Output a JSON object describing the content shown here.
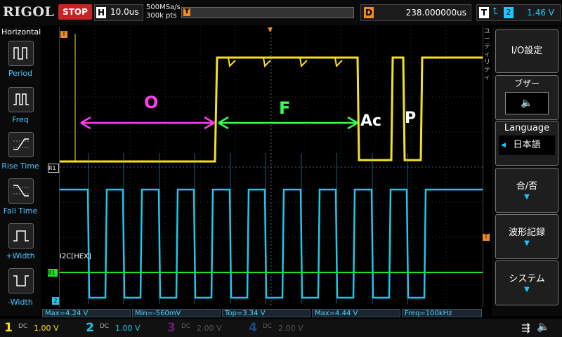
{
  "topbar": {
    "logo": "RIGOL",
    "run_state": "STOP",
    "timebase_tag": "H",
    "timebase": "10.0us",
    "sample_rate": "500MSa/s",
    "memory_depth": "300k pts",
    "trigger_marker": "T",
    "delay_tag": "D",
    "delay": "238.000000us",
    "trigger_tag": "T",
    "trigger_source": "2",
    "trigger_level": "1.46 V"
  },
  "left_panel": {
    "title": "Horizontal",
    "items": [
      {
        "label": "Period"
      },
      {
        "label": "Freq"
      },
      {
        "label": "Rise Time"
      },
      {
        "label": "Fall Time"
      },
      {
        "label": "+Width"
      },
      {
        "label": "-Width"
      }
    ]
  },
  "screen": {
    "annotations": {
      "o_label": "O",
      "f_label": "F",
      "ack_label": "Ac",
      "p_label": "P"
    },
    "markers": {
      "ch1_ref": "R1",
      "bus_ref": "B1",
      "ch2_ref": "2",
      "trig_left": "T",
      "trig_right": "T",
      "bus_label": "I2C[HEX]"
    },
    "scale_labels": [
      "ユ",
      "ー",
      "テ",
      "ィ",
      "リ",
      "テ",
      "ィ"
    ]
  },
  "right_panel": {
    "items": [
      {
        "label": "I/O設定"
      },
      {
        "label": "ブザー"
      },
      {
        "label": "Language"
      },
      {
        "label": "日本語"
      },
      {
        "label": "合/否"
      },
      {
        "label": "波形記録"
      },
      {
        "label": "システム"
      }
    ]
  },
  "measurements": [
    {
      "label": "Max=4.24 V"
    },
    {
      "label": "Min=-560mV"
    },
    {
      "label": "Top=3.34 V"
    },
    {
      "label": "Max=4.44 V"
    },
    {
      "label": "Freq=100kHz"
    }
  ],
  "channels": [
    {
      "num": "1",
      "coupling": "DC",
      "volts": "1.00 V",
      "color": "#f5e11e"
    },
    {
      "num": "2",
      "coupling": "DC",
      "volts": "1.00 V",
      "color": "#1ec8e8"
    },
    {
      "num": "3",
      "coupling": "DC",
      "volts": "2.00 V",
      "color": "#c02ad0"
    },
    {
      "num": "4",
      "coupling": "DC",
      "volts": "2.00 V",
      "color": "#2a7ff0"
    }
  ],
  "colors": {
    "ch1": "#f5e11e",
    "ch2": "#1ec8e8",
    "bus": "#22e22a",
    "accent": "#1ec8ff",
    "trigger": "#f08a24",
    "o_arrow": "#ff3cf0",
    "f_arrow": "#33ff55"
  }
}
